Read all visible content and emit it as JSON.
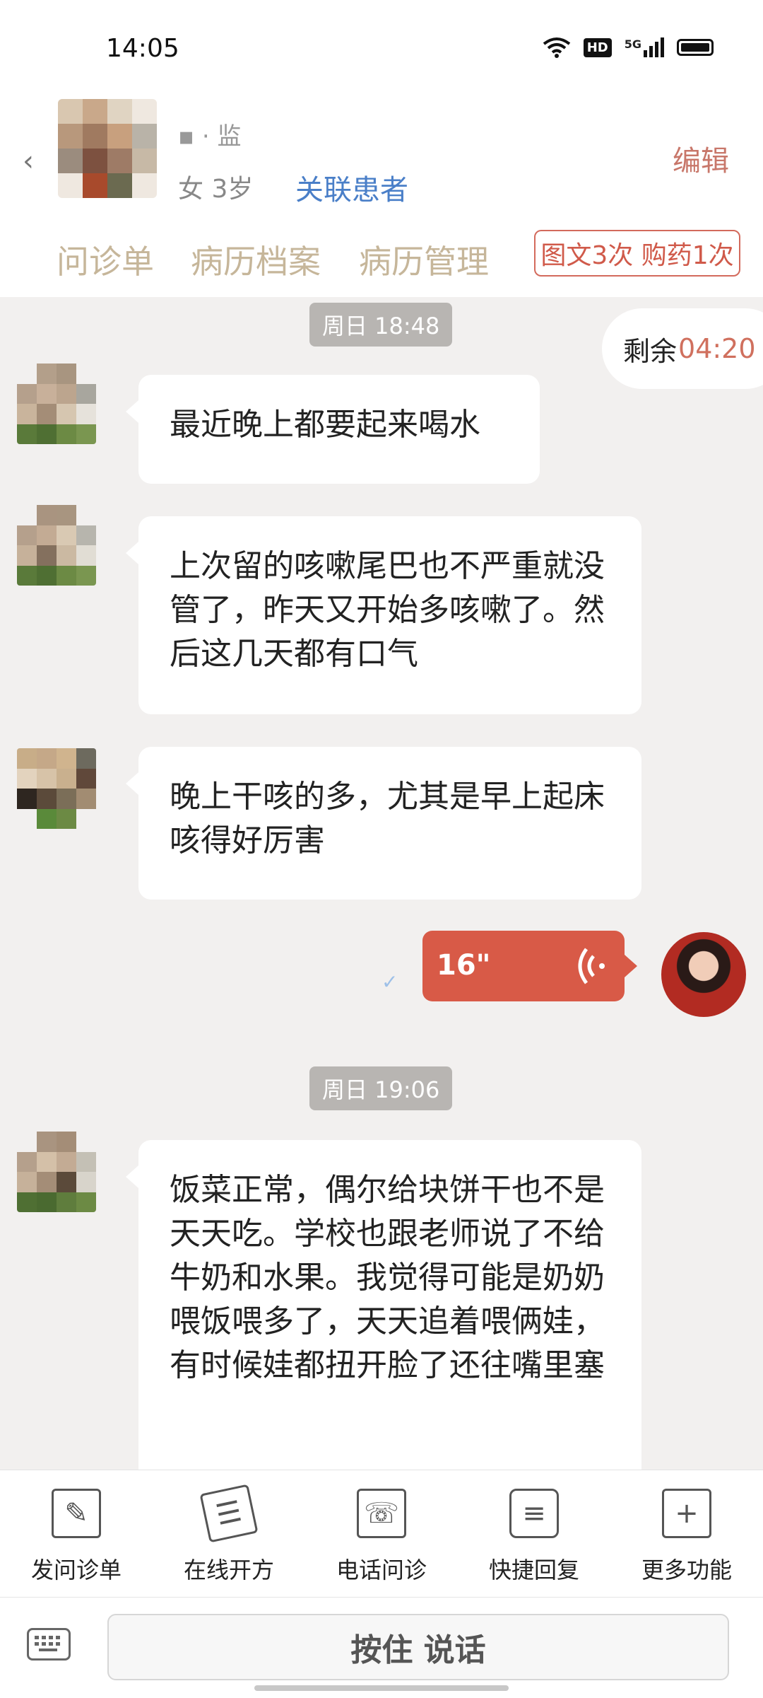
{
  "status_bar": {
    "time": "14:05",
    "hd_label": "HD",
    "net_label": "5G"
  },
  "header": {
    "patient_name": "▪ · 监",
    "patient_info": "女 3岁",
    "link_patient": "关联患者",
    "edit": "编辑",
    "tabs": [
      "问诊单",
      "病历档案",
      "病历管理"
    ],
    "service_badge": "图文3次 购药1次"
  },
  "chat": {
    "time1": "周日 18:48",
    "remain_label": "剩余",
    "remain_time": "04:20",
    "msg1": "最近晚上都要起来喝水",
    "msg2": "上次留的咳嗽尾巴也不严重就没管了，昨天又开始多咳嗽了。然后这几天都有口气",
    "msg3": "晚上干咳的多，尤其是早上起床咳得好厉害",
    "voice_duration": "16\"",
    "read_mark": "✓",
    "time2": "周日 19:06",
    "msg4": "饭菜正常，偶尔给块饼干也不是天天吃。学校也跟老师说了不给牛奶和水果。我觉得可能是奶奶喂饭喂多了，天天追着喂俩娃，有时候娃都扭开脸了还往嘴里塞"
  },
  "toolbar": [
    {
      "label": "发问诊单",
      "icon": "form-icon"
    },
    {
      "label": "在线开方",
      "icon": "prescription-icon"
    },
    {
      "label": "电话问诊",
      "icon": "phone-icon"
    },
    {
      "label": "快捷回复",
      "icon": "quick-reply-icon"
    },
    {
      "label": "更多功能",
      "icon": "more-icon"
    }
  ],
  "input": {
    "push_to_talk": "按住 说话"
  }
}
